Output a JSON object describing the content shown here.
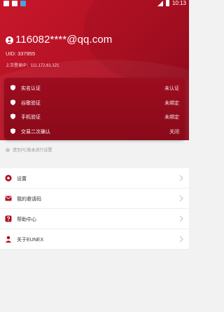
{
  "status_bar": {
    "time": "10:13"
  },
  "profile": {
    "email": "116082****@qq.com",
    "uid": "UID: 337955",
    "last_ip": "上次登录IP：111.172.61.121"
  },
  "security": {
    "items": [
      {
        "label": "实名认证",
        "status": "未认证"
      },
      {
        "label": "谷歌验证",
        "status": "未绑定"
      },
      {
        "label": "手机验证",
        "status": "未绑定"
      },
      {
        "label": "交易二次确认",
        "status": "关闭"
      }
    ]
  },
  "notice": "请至PC版本进行设置",
  "menu": {
    "items": [
      {
        "label": "设置",
        "icon": "gear-icon"
      },
      {
        "label": "我的邀请码",
        "icon": "mail-icon"
      },
      {
        "label": "帮助中心",
        "icon": "help-icon"
      },
      {
        "label": "关于EUNEX",
        "icon": "person-icon"
      }
    ]
  },
  "colors": {
    "accent": "#b01023",
    "card": "#8a0a1a",
    "background": "#f2f2f2"
  }
}
